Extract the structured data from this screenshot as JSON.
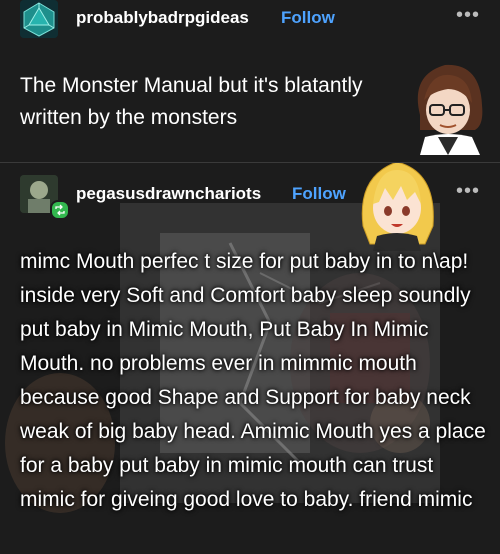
{
  "post1": {
    "username": "probablybadrpgideas",
    "follow_label": "Follow",
    "more_icon": "more-dots-icon",
    "text": "The Monster Manual but it's blatantly written by the monsters"
  },
  "post2": {
    "username": "pegasusdrawnchariots",
    "follow_label": "Follow",
    "more_icon": "more-dots-icon",
    "badge_icon": "reblog-badge-icon",
    "text": "mimc Mouth perfec t size for put baby in to n\\ap! inside very Soft and Comfort baby sleep soundly put baby in Mimic Mouth, Put Baby In Mimic Mouth. no problems ever in mimmic mouth because good Shape and Support for baby neck weak of big baby head. Amimic Mouth yes a place for a baby put baby in mimic mouth can trust mimic for giveing good love to baby. friend mimic"
  },
  "colors": {
    "background": "#1c1c1c",
    "follow": "#4ea3ff",
    "text": "#ffffff"
  }
}
